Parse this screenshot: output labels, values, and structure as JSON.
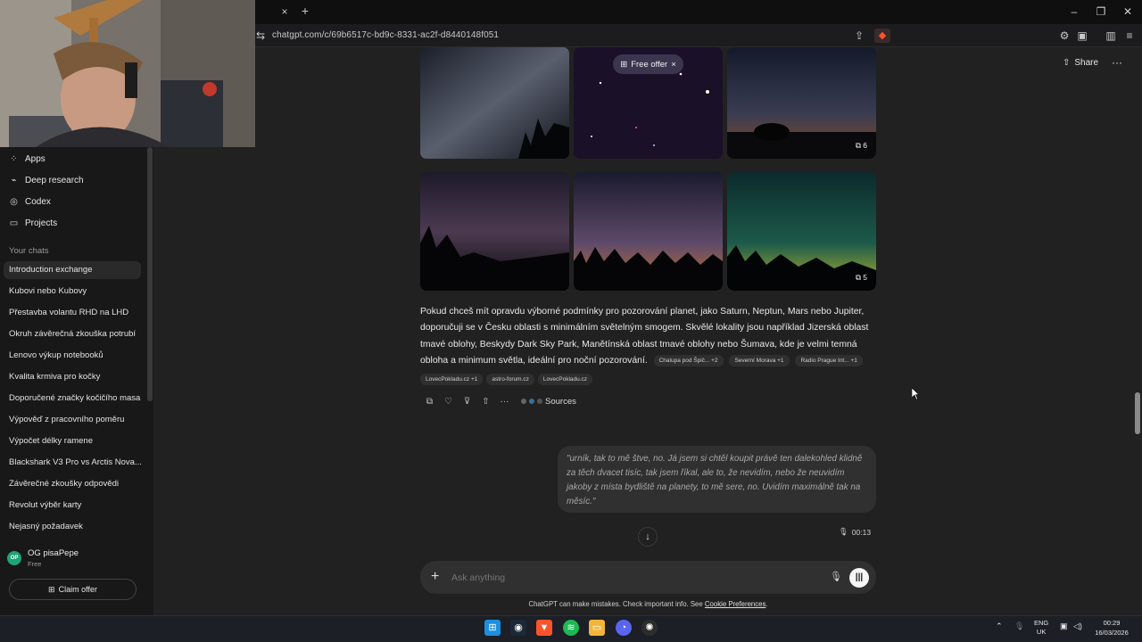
{
  "browser": {
    "url": "chatgpt.com/c/69b6517c-bd9c-8331-ac2f-d8440148f051",
    "tab_close": "×",
    "tab_new": "+",
    "win_minimize": "–",
    "win_restore": "❐",
    "win_close": "✕"
  },
  "sidebar": {
    "nav": [
      {
        "label": "Apps",
        "icon": "apps-icon"
      },
      {
        "label": "Deep research",
        "icon": "telescope-icon"
      },
      {
        "label": "Codex",
        "icon": "codex-icon"
      },
      {
        "label": "Projects",
        "icon": "folder-icon"
      }
    ],
    "section_label": "Your chats",
    "chats": [
      "Introduction exchange",
      "Kubovi nebo Kubovy",
      "Přestavba volantu RHD na LHD",
      "Okruh závěrečná zkouška potrubí",
      "Lenovo výkup notebooků",
      "Kvalita krmiva pro kočky",
      "Doporučené značky kočičího masa",
      "Výpověď z pracovního poměru",
      "Výpočet délky ramene",
      "Blackshark V3 Pro vs Arctis Nova...",
      "Závěrečné zkoušky odpovědi",
      "Revolut výběr karty",
      "Nejasný požadavek"
    ],
    "user": {
      "name": "OG pisaPepe",
      "plan": "Free",
      "initials": "OP"
    },
    "claim_offer": "Claim offer"
  },
  "header": {
    "share_label": "Share",
    "more": "···"
  },
  "gallery": {
    "free_offer": "Free offer",
    "badge_top": "6",
    "badge_bottom": "5"
  },
  "answer": {
    "text": "Pokud chceš mít opravdu výborné podmínky pro pozorování planet, jako Saturn, Neptun, Mars nebo Jupiter, doporučuji se v Česku oblasti s minimálním světelným smogem. Skvělé lokality jsou například Jizerská oblast tmavé oblohy, Beskydy Dark Sky Park, Manětínská oblast tmavé oblohy nebo Šumava, kde je velmi temná obloha a minimum světla, ideální pro noční pozorování.",
    "citations_inline": [
      "Chalupa pod Špič... +2",
      "Severní Morava +1",
      "Radio Prague Int... +1"
    ],
    "citations_row": [
      "LovecPokladu.cz +1",
      "astro-forum.cz",
      "LovecPokladu.cz"
    ],
    "sources_label": "Sources"
  },
  "user_message": {
    "text": "\"urník, tak to mě štve, no. Já jsem si chtěl koupit právě ten dalekohled klidně za těch dvacet tisíc, tak jsem říkal, ale to, že nevidím, nebo že neuvidím jakoby z místa bydliště na planety, to mě sere, no. Uvidím maximálně tak na měsíc.\"",
    "duration": "00:13"
  },
  "composer": {
    "placeholder": "Ask anything",
    "disclaimer_prefix": "ChatGPT can make mistakes. Check important info. See ",
    "disclaimer_link": "Cookie Preferences",
    "disclaimer_suffix": "."
  },
  "taskbar": {
    "lang_top": "ENG",
    "lang_bottom": "UK",
    "time": "00:29",
    "date": "16/03/2026"
  },
  "colors": {
    "background": "#212121",
    "sidebar": "#181818",
    "bubble": "#303030",
    "free_offer": "#3c3550"
  }
}
